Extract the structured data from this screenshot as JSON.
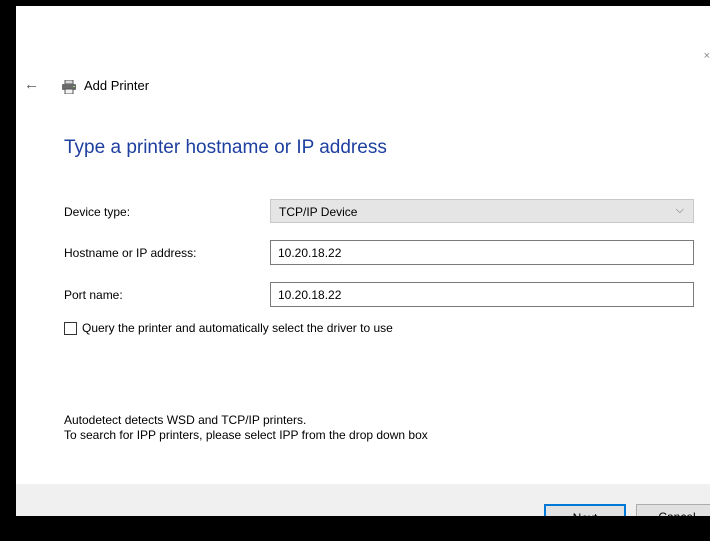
{
  "dialog": {
    "title": "Add Printer",
    "heading": "Type a printer hostname or IP address"
  },
  "form": {
    "device_type_label": "Device type:",
    "device_type_value": "TCP/IP Device",
    "hostname_label": "Hostname or IP address:",
    "hostname_value": "10.20.18.22",
    "port_label": "Port name:",
    "port_value": "10.20.18.22",
    "query_checkbox_label": "Query the printer and automatically select the driver to use",
    "query_checkbox_checked": false
  },
  "info": {
    "line1": "Autodetect detects WSD and TCP/IP printers.",
    "line2": "To search for IPP printers, please select IPP from the drop down box"
  },
  "footer": {
    "next_label": "Next",
    "cancel_label": "Cancel"
  },
  "colors": {
    "heading": "#1e3fa0",
    "accent": "#0078d7"
  }
}
